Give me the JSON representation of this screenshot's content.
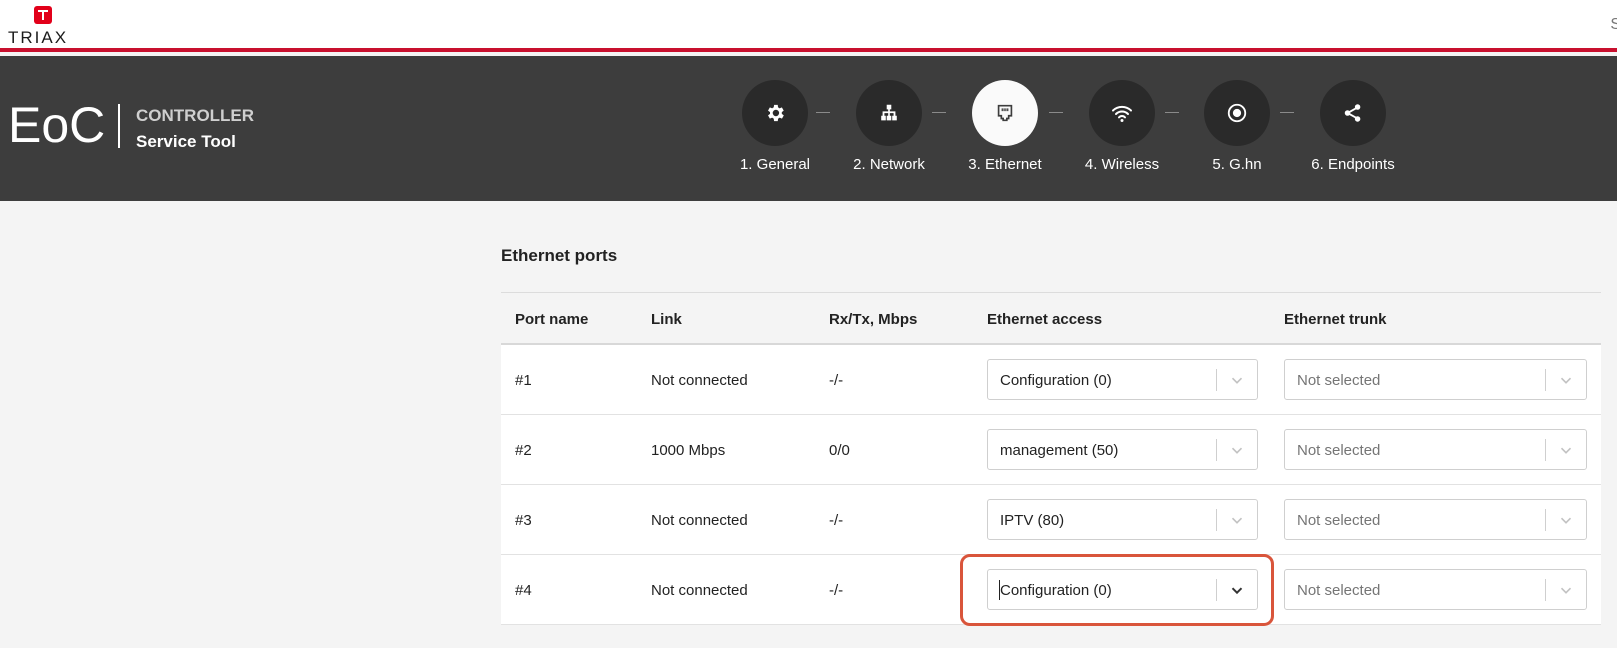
{
  "topbar": {
    "logo_text": "TRIAX",
    "corner_text": "S"
  },
  "header": {
    "brand": "EoC",
    "brand_sub1": "CONTROLLER",
    "brand_sub2": "Service Tool"
  },
  "steps": [
    {
      "label": "1. General",
      "icon": "gear-icon",
      "active": false
    },
    {
      "label": "2. Network",
      "icon": "network-icon",
      "active": false
    },
    {
      "label": "3. Ethernet",
      "icon": "ethernet-port-icon",
      "active": true
    },
    {
      "label": "4. Wireless",
      "icon": "wifi-icon",
      "active": false
    },
    {
      "label": "5. G.hn",
      "icon": "target-icon",
      "active": false
    },
    {
      "label": "6. Endpoints",
      "icon": "share-icon",
      "active": false
    }
  ],
  "section_title": "Ethernet ports",
  "table": {
    "headers": {
      "port_name": "Port name",
      "link": "Link",
      "rxtx": "Rx/Tx, Mbps",
      "access": "Ethernet access",
      "trunk": "Ethernet trunk"
    },
    "rows": [
      {
        "port": "#1",
        "link": "Not connected",
        "rxtx": "-/-",
        "access": "Configuration (0)",
        "trunk": "Not selected"
      },
      {
        "port": "#2",
        "link": "1000 Mbps",
        "rxtx": "0/0",
        "access": "management (50)",
        "trunk": "Not selected"
      },
      {
        "port": "#3",
        "link": "Not connected",
        "rxtx": "-/-",
        "access": "IPTV (80)",
        "trunk": "Not selected"
      },
      {
        "port": "#4",
        "link": "Not connected",
        "rxtx": "-/-",
        "access": "Configuration (0)",
        "trunk": "Not selected"
      }
    ]
  },
  "colors": {
    "accent_red": "#c8102e",
    "header_bg": "#3d3d3d",
    "highlight": "#d9553b"
  }
}
